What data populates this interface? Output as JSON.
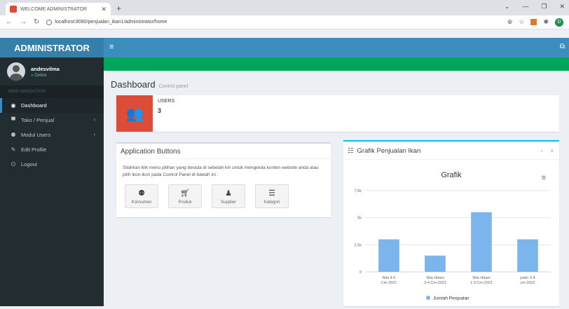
{
  "browser": {
    "tab_title": "WELCOME ADMINISTRATOR",
    "url": "localhost:8080/penjualan_ikan1/administrator/home"
  },
  "header": {
    "logo": "ADMINISTRATOR"
  },
  "user": {
    "name": "andesvilma",
    "status": "Online"
  },
  "sidebar": {
    "header": "MAIN NAVIGATION",
    "items": [
      {
        "label": "Dashboard",
        "icon": "dashboard-icon"
      },
      {
        "label": "Toko / Penjual",
        "icon": "store-icon"
      },
      {
        "label": "Modul Users",
        "icon": "users-icon"
      },
      {
        "label": "Edit Profile",
        "icon": "edit-icon"
      },
      {
        "label": "Logout",
        "icon": "power-icon"
      }
    ]
  },
  "page": {
    "title": "Dashboard",
    "subtitle": "Control panel"
  },
  "infobox": {
    "label": "USERS",
    "count": "3"
  },
  "apps": {
    "title": "Application Buttons",
    "description": "Silahkan klik menu pilihan yang berada di sebelah kiri untuk mengelola konten website anda atau pilih ikon-ikon pada Control Panel di bawah ini :",
    "buttons": [
      {
        "label": "Konsumen",
        "icon": "users-icon"
      },
      {
        "label": "Produk",
        "icon": "cart-icon"
      },
      {
        "label": "Supplier",
        "icon": "user-icon"
      },
      {
        "label": "Kategori",
        "icon": "list-icon"
      }
    ]
  },
  "chart_box": {
    "title": "Grafik Penjualan Ikan",
    "collapse": "−",
    "close": "×"
  },
  "chart_data": {
    "type": "bar",
    "title": "Grafik",
    "categories": [
      "Nila 4-5 Cm-2021",
      "Nila Hitam 3-4 Cm-2021",
      "Nila Hitam 1-3 Cm-2021",
      "patin 3-4 cm-2022"
    ],
    "series": [
      {
        "name": "Jumlah Penjualan",
        "values": [
          3,
          1.5,
          5.5,
          3
        ]
      }
    ],
    "yticks": [
      "0",
      "2.5k",
      "5k",
      "7.5k"
    ],
    "ylim": [
      0,
      7.5
    ],
    "color": "#7cb5ec",
    "legend": "bottom"
  }
}
